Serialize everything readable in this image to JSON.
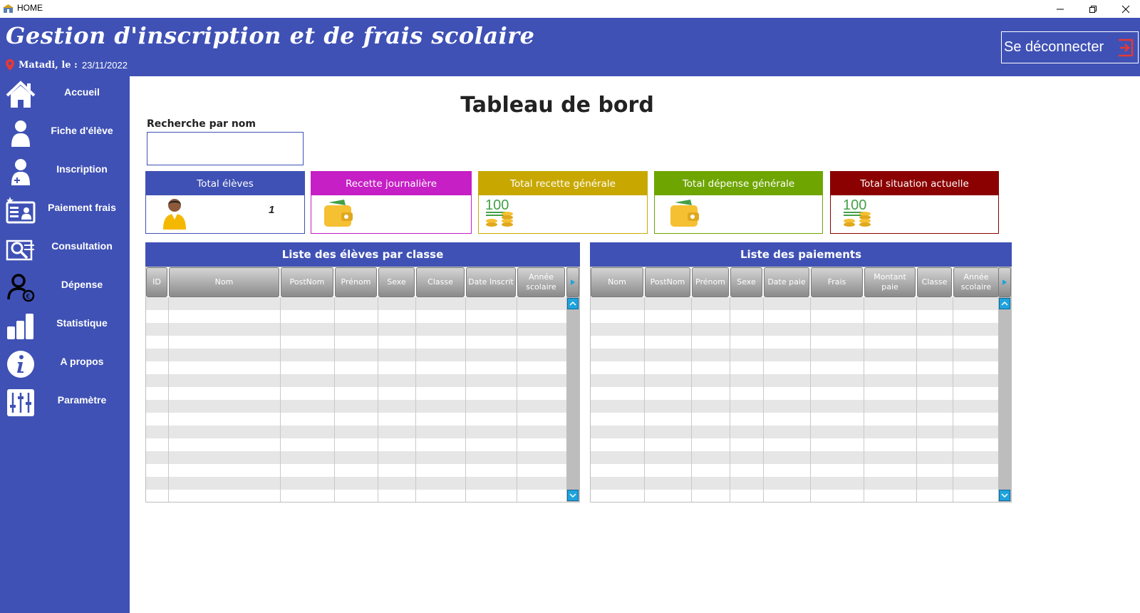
{
  "window": {
    "title": "HOME"
  },
  "header": {
    "app_title": "Gestion d'inscription et de frais scolaire",
    "city_label": "Matadi, le :",
    "date": "23/11/2022",
    "logout_label": "Se déconnecter"
  },
  "sidebar": {
    "items": [
      {
        "label": "Accueil",
        "icon": "home-icon"
      },
      {
        "label": "Fiche d'élève",
        "icon": "user-icon"
      },
      {
        "label": "Inscription",
        "icon": "user-add-icon"
      },
      {
        "label": "Paiement frais",
        "icon": "id-card-icon"
      },
      {
        "label": "Consultation",
        "icon": "search-document-icon"
      },
      {
        "label": "Dépense",
        "icon": "user-euro-icon"
      },
      {
        "label": "Statistique",
        "icon": "bar-chart-icon"
      },
      {
        "label": "A propos",
        "icon": "info-icon"
      },
      {
        "label": "Paramètre",
        "icon": "sliders-icon"
      }
    ]
  },
  "main": {
    "title": "Tableau de bord",
    "search_label": "Recherche par nom",
    "search_value": ""
  },
  "cards": [
    {
      "label": "Total élèves",
      "value": "1",
      "color": "#3f51b5",
      "icon": "student-icon"
    },
    {
      "label": "Recette journalière",
      "value": "",
      "color": "#c51fc5",
      "icon": "wallet-icon"
    },
    {
      "label": "Total recette générale",
      "value": "",
      "color": "#c8a800",
      "icon": "money-coins-icon"
    },
    {
      "label": "Total dépense générale",
      "value": "",
      "color": "#6ea500",
      "icon": "wallet-icon"
    },
    {
      "label": "Total situation actuelle",
      "value": "",
      "color": "#8b0000",
      "icon": "money-coins-icon"
    }
  ],
  "tables": {
    "students": {
      "title": "Liste des élèves par classe",
      "columns": [
        "ID",
        "Nom",
        "PostNom",
        "Prénom",
        "Sexe",
        "Classe",
        "Date Inscrit",
        "Année scolaire"
      ]
    },
    "payments": {
      "title": "Liste des paiements",
      "columns": [
        "Nom",
        "PostNom",
        "Prénom",
        "Sexe",
        "Date paie",
        "Frais",
        "Montant paie",
        "Classe",
        "Année scolaire"
      ]
    }
  },
  "colors": {
    "primary": "#3f51b5",
    "accent_red": "#e53935"
  }
}
